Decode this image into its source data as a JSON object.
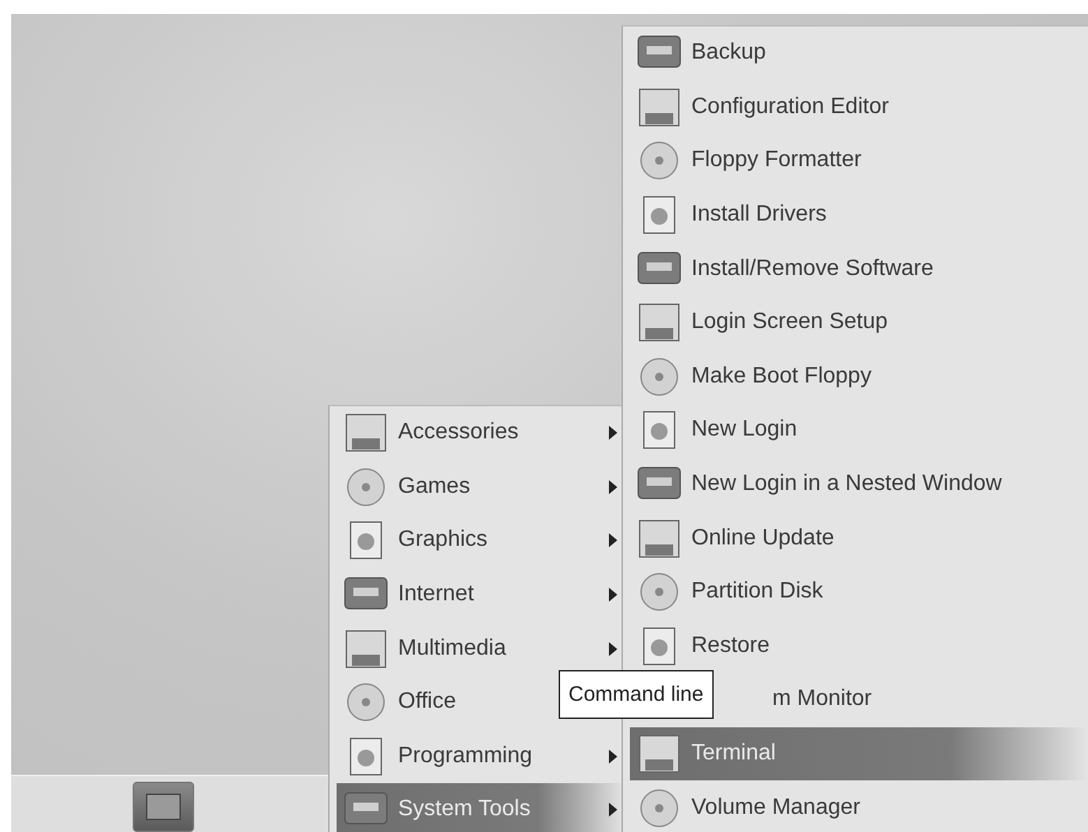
{
  "applications_menu": {
    "items": [
      {
        "label": "Accessories",
        "submenu": true,
        "selected": false
      },
      {
        "label": "Games",
        "submenu": true,
        "selected": false
      },
      {
        "label": "Graphics",
        "submenu": true,
        "selected": false
      },
      {
        "label": "Internet",
        "submenu": true,
        "selected": false
      },
      {
        "label": "Multimedia",
        "submenu": true,
        "selected": false
      },
      {
        "label": "Office",
        "submenu": false,
        "selected": false
      },
      {
        "label": "Programming",
        "submenu": true,
        "selected": false
      },
      {
        "label": "System Tools",
        "submenu": true,
        "selected": true
      }
    ]
  },
  "system_tools_menu": {
    "items": [
      {
        "label": "Backup",
        "selected": false
      },
      {
        "label": "Configuration Editor",
        "selected": false
      },
      {
        "label": "Floppy Formatter",
        "selected": false
      },
      {
        "label": "Install Drivers",
        "selected": false
      },
      {
        "label": "Install/Remove Software",
        "selected": false
      },
      {
        "label": "Login Screen Setup",
        "selected": false
      },
      {
        "label": "Make Boot Floppy",
        "selected": false
      },
      {
        "label": "New Login",
        "selected": false
      },
      {
        "label": "New Login in a Nested Window",
        "selected": false
      },
      {
        "label": "Online Update",
        "selected": false
      },
      {
        "label": "Partition Disk",
        "selected": false
      },
      {
        "label": "Restore",
        "selected": false
      },
      {
        "label": "m Monitor",
        "selected": false,
        "covered": true
      },
      {
        "label": "Terminal",
        "selected": true
      },
      {
        "label": "Volume Manager",
        "selected": false
      }
    ]
  },
  "tooltip": {
    "text": "Command line"
  }
}
